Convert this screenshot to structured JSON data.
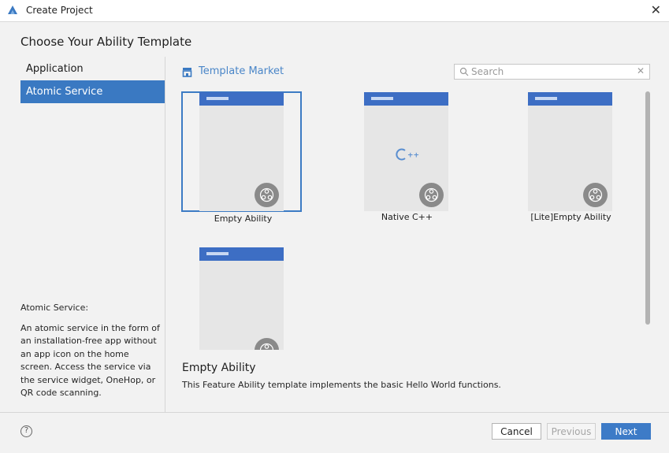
{
  "window": {
    "title": "Create Project"
  },
  "heading": "Choose Your Ability Template",
  "sidebar": {
    "items": [
      {
        "label": "Application",
        "selected": false
      },
      {
        "label": "Atomic Service",
        "selected": true
      }
    ],
    "description_title": "Atomic Service:",
    "description_text": "An atomic service in the form of an installation-free app without an app icon on the home screen. Access the service via the service widget, OneHop, or QR code scanning."
  },
  "market": {
    "label": "Template Market",
    "icon": "store-icon"
  },
  "search": {
    "placeholder": "Search",
    "value": ""
  },
  "templates": [
    {
      "label": "Empty Ability",
      "selected": true,
      "badge_icon": "atomic-service-icon"
    },
    {
      "label": "Native C++",
      "selected": false,
      "badge_icon": "atomic-service-icon",
      "center_glyph": "C++"
    },
    {
      "label": "[Lite]Empty Ability",
      "selected": false,
      "badge_icon": "atomic-service-icon"
    },
    {
      "label": "",
      "selected": false,
      "badge_icon": "atomic-service-icon"
    }
  ],
  "detail": {
    "title": "Empty Ability",
    "description": "This Feature Ability template implements the basic Hello World functions."
  },
  "footer": {
    "cancel_label": "Cancel",
    "previous_label": "Previous",
    "next_label": "Next"
  },
  "colors": {
    "accent": "#3d7bc7",
    "selection": "#3a79c2",
    "card_header": "#3d6ec4"
  }
}
